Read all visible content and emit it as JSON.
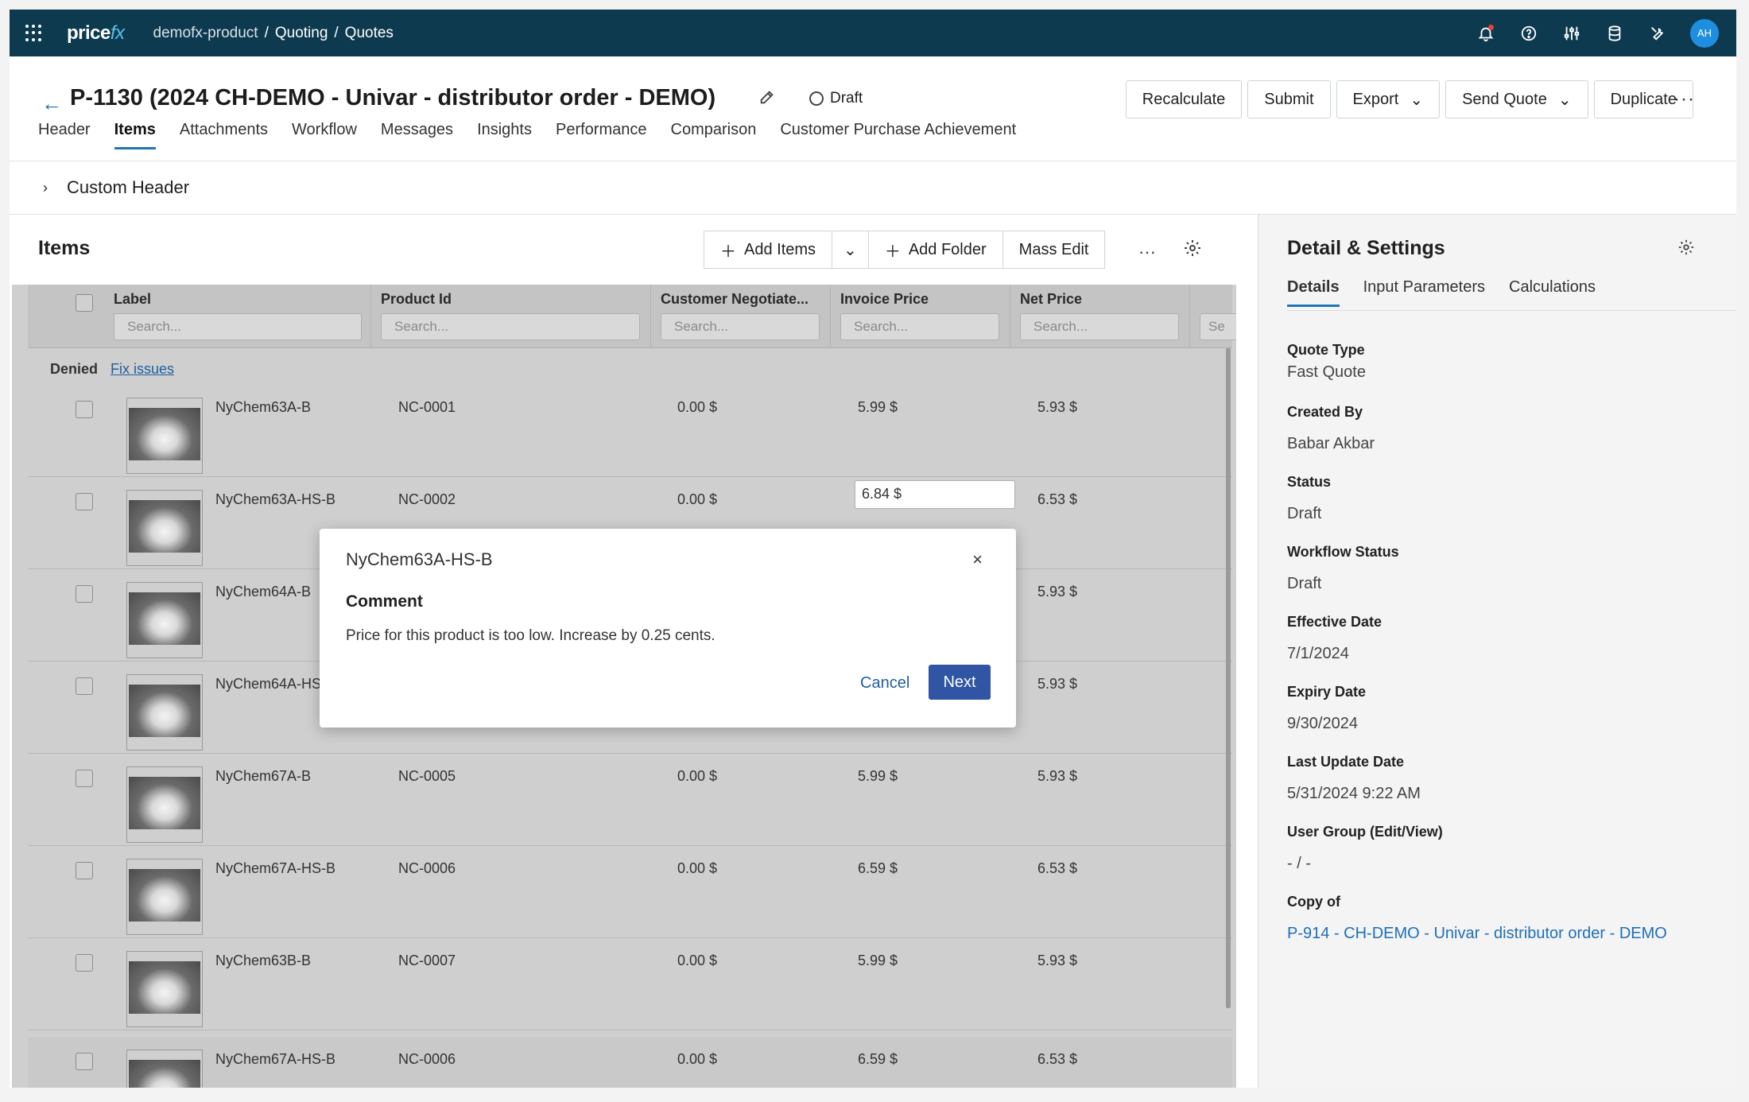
{
  "topbar": {
    "logo_main": "price",
    "logo_accent": "fx",
    "breadcrumb": [
      "demofx-product",
      "/",
      "Quoting",
      "/",
      "Quotes"
    ],
    "avatar_initials": "AH",
    "icons": [
      "notification-bell-icon",
      "help-icon",
      "sliders-icon",
      "database-icon",
      "tools-icon"
    ]
  },
  "title": {
    "text": "P-1130 (2024 CH-DEMO - Univar - distributor order - DEMO)",
    "status": "Draft"
  },
  "actions": {
    "recalculate": "Recalculate",
    "submit": "Submit",
    "export": "Export",
    "send_quote": "Send Quote",
    "duplicate": "Duplicate",
    "more": "···"
  },
  "tabs": [
    "Header",
    "Items",
    "Attachments",
    "Workflow",
    "Messages",
    "Insights",
    "Performance",
    "Comparison",
    "Customer Purchase Achievement"
  ],
  "custom_header": "Custom Header",
  "items": {
    "title": "Items",
    "add_items": "Add Items",
    "add_folder": "Add Folder",
    "mass_edit": "Mass Edit",
    "columns": [
      "Label",
      "Product Id",
      "Customer Negotiate...",
      "Invoice Price",
      "Net Price",
      "Se"
    ],
    "search_placeholder": "Search...",
    "group_label": "Denied",
    "fix_issues": "Fix issues",
    "rows": [
      {
        "label": "NyChem63A-B",
        "pid": "NC-0001",
        "neg": "0.00 $",
        "inv": "5.99 $",
        "net": "5.93 $"
      },
      {
        "label": "NyChem63A-HS-B",
        "pid": "NC-0002",
        "neg": "0.00 $",
        "inv": "6.84 $",
        "net": "6.53 $"
      },
      {
        "label": "NyChem64A-B",
        "pid": "",
        "neg": "",
        "inv": "",
        "net": "5.93 $"
      },
      {
        "label": "NyChem64A-HS",
        "pid": "",
        "neg": "",
        "inv": "",
        "net": "5.93 $"
      },
      {
        "label": "NyChem67A-B",
        "pid": "NC-0005",
        "neg": "0.00 $",
        "inv": "5.99 $",
        "net": "5.93 $"
      },
      {
        "label": "NyChem67A-HS-B",
        "pid": "NC-0006",
        "neg": "0.00 $",
        "inv": "6.59 $",
        "net": "6.53 $"
      },
      {
        "label": "NyChem63B-B",
        "pid": "NC-0007",
        "neg": "0.00 $",
        "inv": "5.99 $",
        "net": "5.93 $"
      },
      {
        "label": "NyChem67A-HS-B",
        "pid": "NC-0006",
        "neg": "0.00 $",
        "inv": "6.59 $",
        "net": "6.53 $"
      }
    ]
  },
  "detail": {
    "title": "Detail & Settings",
    "tabs": [
      "Details",
      "Input Parameters",
      "Calculations"
    ],
    "fields": [
      {
        "key": "Quote Type",
        "value": "Fast Quote"
      },
      {
        "key": "Created By",
        "value": "Babar Akbar"
      },
      {
        "key": "Status",
        "value": "Draft"
      },
      {
        "key": "Workflow Status",
        "value": "Draft"
      },
      {
        "key": "Effective Date",
        "value": "7/1/2024"
      },
      {
        "key": "Expiry Date",
        "value": "9/30/2024"
      },
      {
        "key": "Last Update Date",
        "value": "5/31/2024 9:22 AM"
      },
      {
        "key": "User Group (Edit/View)",
        "value": "- / -"
      },
      {
        "key": "Copy of",
        "value": "P-914 - CH-DEMO - Univar - distributor order - DEMO"
      }
    ]
  },
  "dialog": {
    "title": "NyChem63A-HS-B",
    "subtitle": "Comment",
    "text": "Price for this product is too low. Increase by 0.25 cents.",
    "cancel": "Cancel",
    "next": "Next",
    "close": "×"
  }
}
